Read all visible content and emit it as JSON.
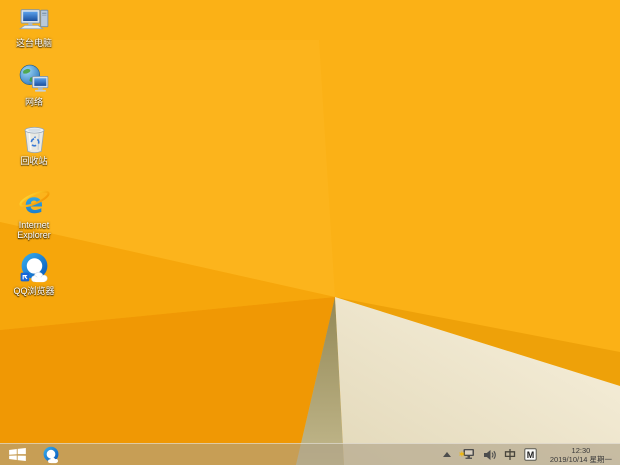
{
  "wallpaper": {
    "base": "#fbb116",
    "light_facet": "#fcb41c",
    "dark_left_upper": "#f6a60b",
    "dark_left_lower": "#f09804",
    "shadow_olive_top": "#938856",
    "shadow_olive_bottom": "#c2b88c",
    "band": "#eea109",
    "cream_light": "#f8f1de",
    "cream_dark": "#e3d9ba"
  },
  "desktop_icons": [
    {
      "label": "这台电脑"
    },
    {
      "label": "网络"
    },
    {
      "label": "回收站"
    },
    {
      "label": "Internet Explorer"
    },
    {
      "label": "QQ浏览器"
    }
  ],
  "taskbar": {
    "tray": {
      "ime_lang": "中",
      "ime_mode": "M",
      "time": "12:30",
      "date": "2019/10/14 星期一"
    }
  }
}
